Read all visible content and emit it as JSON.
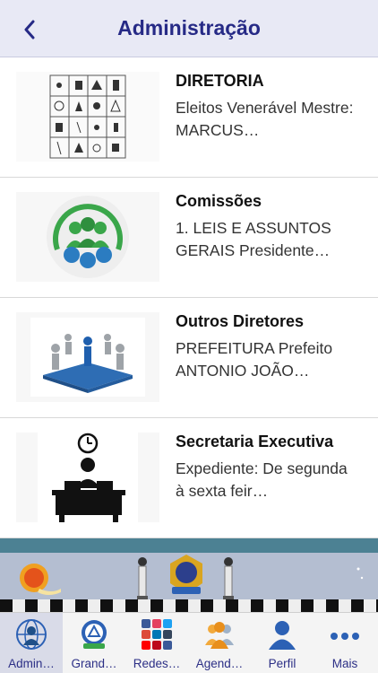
{
  "header": {
    "title": "Administração",
    "back_icon": "chevron-left-icon"
  },
  "items": [
    {
      "title": "DIRETORIA",
      "desc": "Eleitos Venerável Mestre: MARCUS…",
      "thumb": "masonic-symbols-grid"
    },
    {
      "title": "Comissões",
      "desc": "1. LEIS E ASSUNTOS GERAIS Presidente…",
      "thumb": "team-circle-logo"
    },
    {
      "title": "Outros Diretores",
      "desc": "PREFEITURA Prefeito ANTONIO JOÃO…",
      "thumb": "people-puzzle-figures"
    },
    {
      "title": "Secretaria Executiva",
      "desc": "Expediente: De segunda à sexta feir…",
      "thumb": "clock-desk-person"
    }
  ],
  "tabs": [
    {
      "label": "Admin…",
      "icon": "globe-person-icon",
      "active": true
    },
    {
      "label": "Grand…",
      "icon": "lodge-emblem-icon",
      "active": false
    },
    {
      "label": "Redes…",
      "icon": "social-networks-icon",
      "active": false
    },
    {
      "label": "Agend…",
      "icon": "people-group-icon",
      "active": false
    },
    {
      "label": "Perfil",
      "icon": "person-icon",
      "active": false
    },
    {
      "label": "Mais",
      "icon": "more-dots-icon",
      "active": false
    }
  ],
  "colors": {
    "accent": "#262a86",
    "nav_bg": "#e8e9f5",
    "band": "#4c8193",
    "tab_active_bg": "#d9dbe8"
  }
}
